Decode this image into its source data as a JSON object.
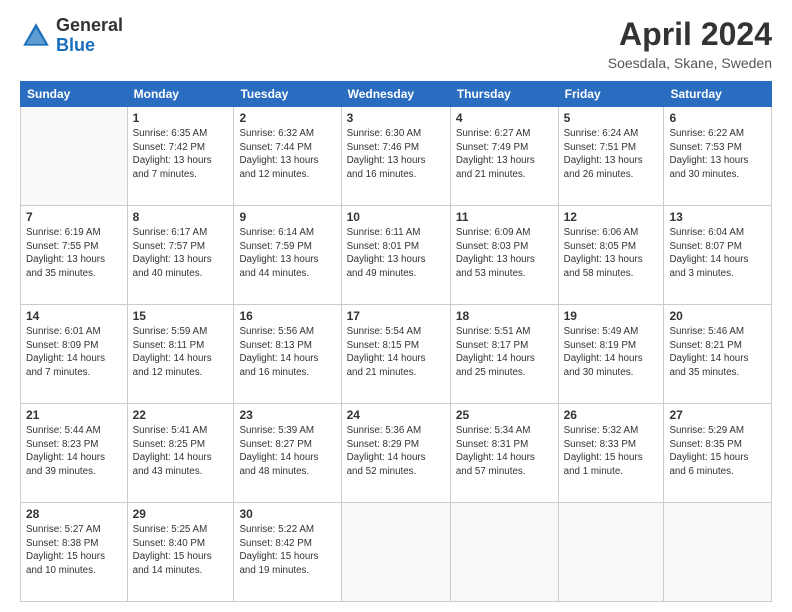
{
  "header": {
    "logo_general": "General",
    "logo_blue": "Blue",
    "month_title": "April 2024",
    "location": "Soesdala, Skane, Sweden"
  },
  "days_of_week": [
    "Sunday",
    "Monday",
    "Tuesday",
    "Wednesday",
    "Thursday",
    "Friday",
    "Saturday"
  ],
  "weeks": [
    [
      {
        "num": "",
        "info": ""
      },
      {
        "num": "1",
        "info": "Sunrise: 6:35 AM\nSunset: 7:42 PM\nDaylight: 13 hours\nand 7 minutes."
      },
      {
        "num": "2",
        "info": "Sunrise: 6:32 AM\nSunset: 7:44 PM\nDaylight: 13 hours\nand 12 minutes."
      },
      {
        "num": "3",
        "info": "Sunrise: 6:30 AM\nSunset: 7:46 PM\nDaylight: 13 hours\nand 16 minutes."
      },
      {
        "num": "4",
        "info": "Sunrise: 6:27 AM\nSunset: 7:49 PM\nDaylight: 13 hours\nand 21 minutes."
      },
      {
        "num": "5",
        "info": "Sunrise: 6:24 AM\nSunset: 7:51 PM\nDaylight: 13 hours\nand 26 minutes."
      },
      {
        "num": "6",
        "info": "Sunrise: 6:22 AM\nSunset: 7:53 PM\nDaylight: 13 hours\nand 30 minutes."
      }
    ],
    [
      {
        "num": "7",
        "info": "Sunrise: 6:19 AM\nSunset: 7:55 PM\nDaylight: 13 hours\nand 35 minutes."
      },
      {
        "num": "8",
        "info": "Sunrise: 6:17 AM\nSunset: 7:57 PM\nDaylight: 13 hours\nand 40 minutes."
      },
      {
        "num": "9",
        "info": "Sunrise: 6:14 AM\nSunset: 7:59 PM\nDaylight: 13 hours\nand 44 minutes."
      },
      {
        "num": "10",
        "info": "Sunrise: 6:11 AM\nSunset: 8:01 PM\nDaylight: 13 hours\nand 49 minutes."
      },
      {
        "num": "11",
        "info": "Sunrise: 6:09 AM\nSunset: 8:03 PM\nDaylight: 13 hours\nand 53 minutes."
      },
      {
        "num": "12",
        "info": "Sunrise: 6:06 AM\nSunset: 8:05 PM\nDaylight: 13 hours\nand 58 minutes."
      },
      {
        "num": "13",
        "info": "Sunrise: 6:04 AM\nSunset: 8:07 PM\nDaylight: 14 hours\nand 3 minutes."
      }
    ],
    [
      {
        "num": "14",
        "info": "Sunrise: 6:01 AM\nSunset: 8:09 PM\nDaylight: 14 hours\nand 7 minutes."
      },
      {
        "num": "15",
        "info": "Sunrise: 5:59 AM\nSunset: 8:11 PM\nDaylight: 14 hours\nand 12 minutes."
      },
      {
        "num": "16",
        "info": "Sunrise: 5:56 AM\nSunset: 8:13 PM\nDaylight: 14 hours\nand 16 minutes."
      },
      {
        "num": "17",
        "info": "Sunrise: 5:54 AM\nSunset: 8:15 PM\nDaylight: 14 hours\nand 21 minutes."
      },
      {
        "num": "18",
        "info": "Sunrise: 5:51 AM\nSunset: 8:17 PM\nDaylight: 14 hours\nand 25 minutes."
      },
      {
        "num": "19",
        "info": "Sunrise: 5:49 AM\nSunset: 8:19 PM\nDaylight: 14 hours\nand 30 minutes."
      },
      {
        "num": "20",
        "info": "Sunrise: 5:46 AM\nSunset: 8:21 PM\nDaylight: 14 hours\nand 35 minutes."
      }
    ],
    [
      {
        "num": "21",
        "info": "Sunrise: 5:44 AM\nSunset: 8:23 PM\nDaylight: 14 hours\nand 39 minutes."
      },
      {
        "num": "22",
        "info": "Sunrise: 5:41 AM\nSunset: 8:25 PM\nDaylight: 14 hours\nand 43 minutes."
      },
      {
        "num": "23",
        "info": "Sunrise: 5:39 AM\nSunset: 8:27 PM\nDaylight: 14 hours\nand 48 minutes."
      },
      {
        "num": "24",
        "info": "Sunrise: 5:36 AM\nSunset: 8:29 PM\nDaylight: 14 hours\nand 52 minutes."
      },
      {
        "num": "25",
        "info": "Sunrise: 5:34 AM\nSunset: 8:31 PM\nDaylight: 14 hours\nand 57 minutes."
      },
      {
        "num": "26",
        "info": "Sunrise: 5:32 AM\nSunset: 8:33 PM\nDaylight: 15 hours\nand 1 minute."
      },
      {
        "num": "27",
        "info": "Sunrise: 5:29 AM\nSunset: 8:35 PM\nDaylight: 15 hours\nand 6 minutes."
      }
    ],
    [
      {
        "num": "28",
        "info": "Sunrise: 5:27 AM\nSunset: 8:38 PM\nDaylight: 15 hours\nand 10 minutes."
      },
      {
        "num": "29",
        "info": "Sunrise: 5:25 AM\nSunset: 8:40 PM\nDaylight: 15 hours\nand 14 minutes."
      },
      {
        "num": "30",
        "info": "Sunrise: 5:22 AM\nSunset: 8:42 PM\nDaylight: 15 hours\nand 19 minutes."
      },
      {
        "num": "",
        "info": ""
      },
      {
        "num": "",
        "info": ""
      },
      {
        "num": "",
        "info": ""
      },
      {
        "num": "",
        "info": ""
      }
    ]
  ]
}
